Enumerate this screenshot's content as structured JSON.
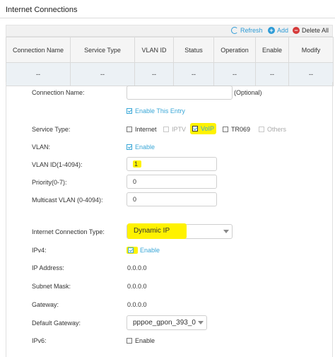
{
  "page": {
    "title": "Internet Connections"
  },
  "toolbar": {
    "refresh": "Refresh",
    "add": "Add",
    "delete_all": "Delete All"
  },
  "table": {
    "headers": [
      "Connection Name",
      "Service Type",
      "VLAN ID",
      "Status",
      "Operation",
      "Enable",
      "Modify"
    ],
    "row": [
      "--",
      "--",
      "--",
      "--",
      "--",
      "--",
      "--"
    ]
  },
  "form": {
    "connection_name": {
      "label": "Connection Name:",
      "value": "",
      "hint": "(Optional)"
    },
    "enable_entry": {
      "label": "Enable This Entry",
      "checked": true
    },
    "service_type": {
      "label": "Service Type:",
      "options": [
        {
          "label": "Internet",
          "checked": false,
          "disabled": false
        },
        {
          "label": "IPTV",
          "checked": false,
          "disabled": true
        },
        {
          "label": "VoIP",
          "checked": true,
          "disabled": false
        },
        {
          "label": "TR069",
          "checked": false,
          "disabled": false
        },
        {
          "label": "Others",
          "checked": false,
          "disabled": true
        }
      ]
    },
    "vlan": {
      "label": "VLAN:",
      "option": "Enable",
      "checked": true
    },
    "vlan_id": {
      "label": "VLAN ID(1-4094):",
      "value": "1"
    },
    "priority": {
      "label": "Priority(0-7):",
      "value": "0"
    },
    "multicast_vlan": {
      "label": "Multicast VLAN (0-4094):",
      "value": "0"
    },
    "connection_type": {
      "label": "Internet Connection Type:",
      "value": "Dynamic IP"
    },
    "ipv4": {
      "label": "IPv4:",
      "option": "Enable",
      "checked": true
    },
    "ip_address": {
      "label": "IP Address:",
      "value": "0.0.0.0"
    },
    "subnet_mask": {
      "label": "Subnet Mask:",
      "value": "0.0.0.0"
    },
    "gateway": {
      "label": "Gateway:",
      "value": "0.0.0.0"
    },
    "default_gateway": {
      "label": "Default Gateway:",
      "value": "pppoe_gpon_393_0"
    },
    "ipv6": {
      "label": "IPv6:",
      "option": "Enable",
      "checked": false
    }
  },
  "colors": {
    "accent": "#3aa7d7",
    "highlight": "#fff200",
    "delete": "#d53a3a"
  }
}
